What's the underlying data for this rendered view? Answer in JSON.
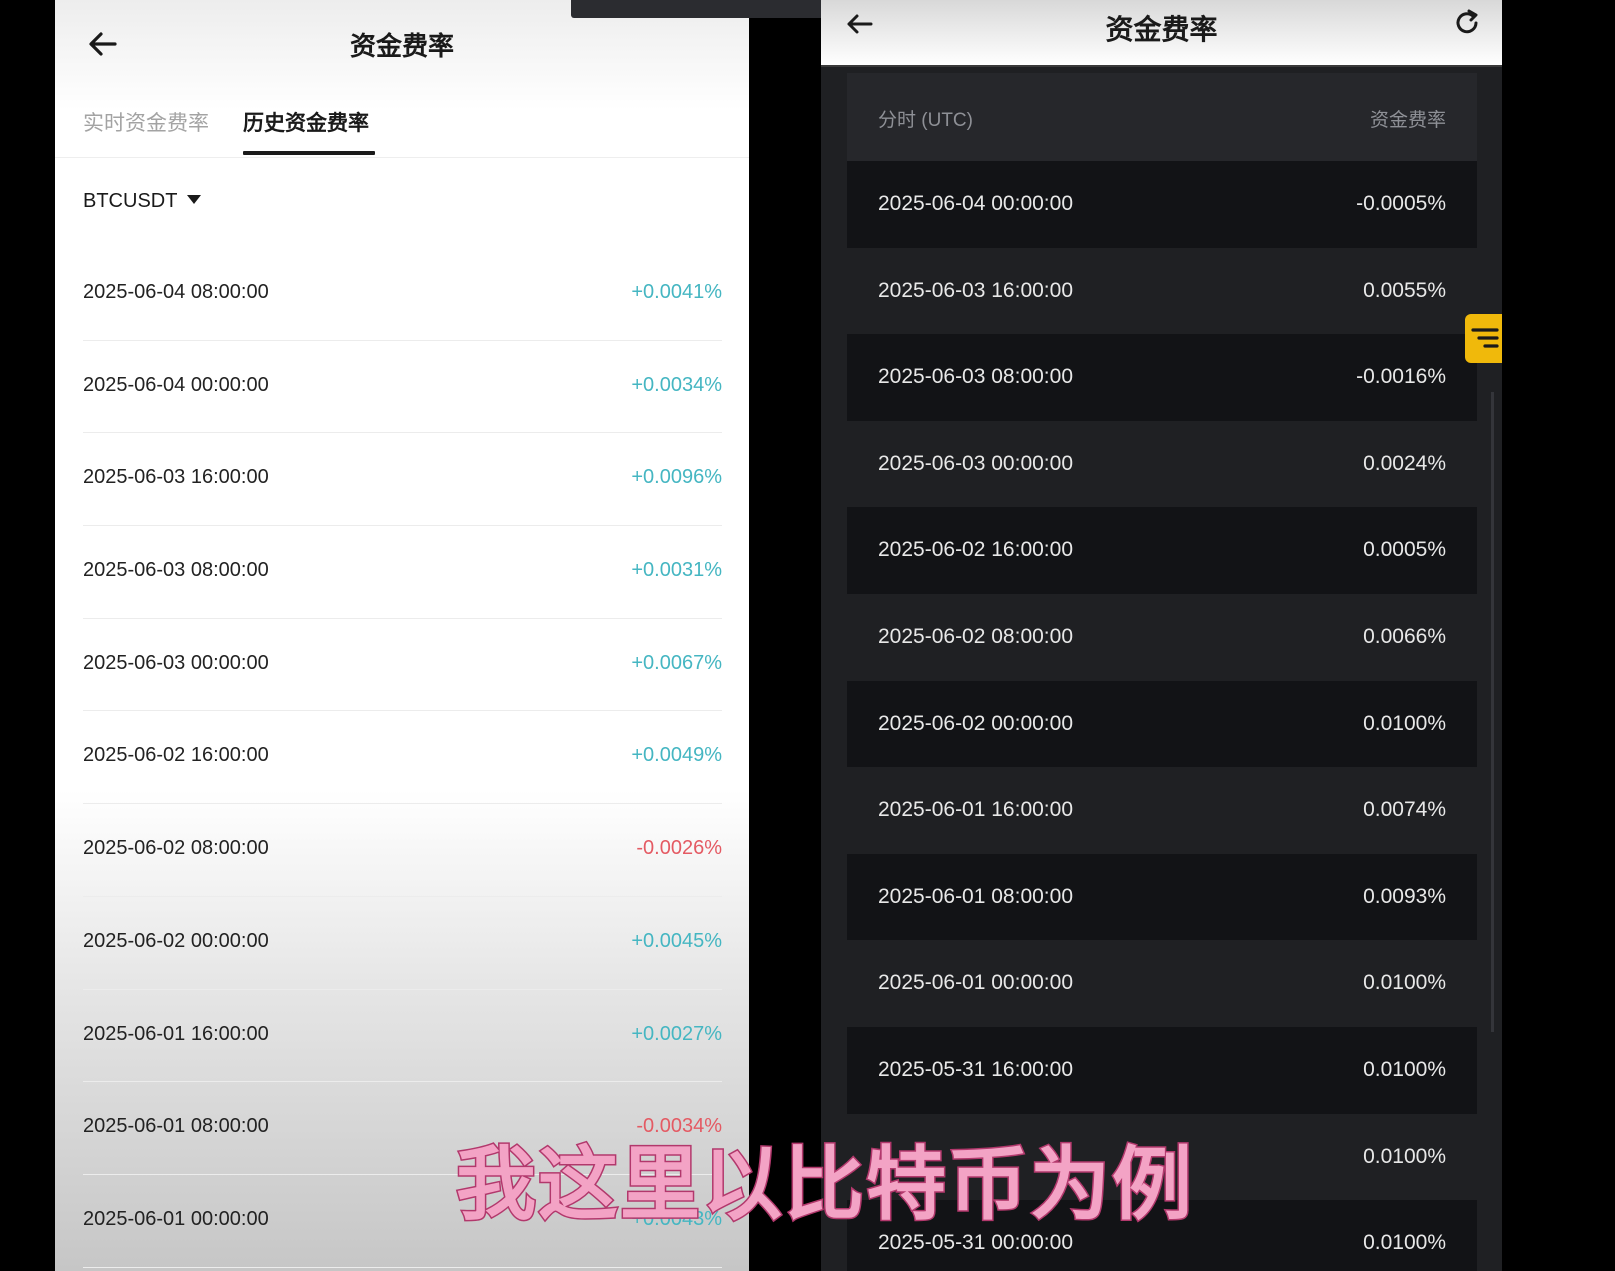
{
  "left": {
    "title": "资金费率",
    "tabs": [
      "实时资金费率",
      "历史资金费率"
    ],
    "pair": "BTCUSDT",
    "rows": [
      {
        "time": "2025-06-04 08:00:00",
        "rate": "+0.0041%",
        "sign": "pos"
      },
      {
        "time": "2025-06-04 00:00:00",
        "rate": "+0.0034%",
        "sign": "pos"
      },
      {
        "time": "2025-06-03 16:00:00",
        "rate": "+0.0096%",
        "sign": "pos"
      },
      {
        "time": "2025-06-03 08:00:00",
        "rate": "+0.0031%",
        "sign": "pos"
      },
      {
        "time": "2025-06-03 00:00:00",
        "rate": "+0.0067%",
        "sign": "pos"
      },
      {
        "time": "2025-06-02 16:00:00",
        "rate": "+0.0049%",
        "sign": "pos"
      },
      {
        "time": "2025-06-02 08:00:00",
        "rate": "-0.0026%",
        "sign": "neg"
      },
      {
        "time": "2025-06-02 00:00:00",
        "rate": "+0.0045%",
        "sign": "pos"
      },
      {
        "time": "2025-06-01 16:00:00",
        "rate": "+0.0027%",
        "sign": "pos"
      },
      {
        "time": "2025-06-01 08:00:00",
        "rate": "-0.0034%",
        "sign": "neg"
      },
      {
        "time": "2025-06-01 00:00:00",
        "rate": "+0.0043%",
        "sign": "pos"
      }
    ]
  },
  "right": {
    "title": "资金费率",
    "col_time": "分时 (UTC)",
    "col_rate": "资金费率",
    "rows": [
      {
        "time": "2025-06-04 00:00:00",
        "rate": "-0.0005%"
      },
      {
        "time": "2025-06-03 16:00:00",
        "rate": "0.0055%"
      },
      {
        "time": "2025-06-03 08:00:00",
        "rate": "-0.0016%"
      },
      {
        "time": "2025-06-03 00:00:00",
        "rate": "0.0024%"
      },
      {
        "time": "2025-06-02 16:00:00",
        "rate": "0.0005%"
      },
      {
        "time": "2025-06-02 08:00:00",
        "rate": "0.0066%"
      },
      {
        "time": "2025-06-02 00:00:00",
        "rate": "0.0100%"
      },
      {
        "time": "2025-06-01 16:00:00",
        "rate": "0.0074%"
      },
      {
        "time": "2025-06-01 08:00:00",
        "rate": "0.0093%"
      },
      {
        "time": "2025-06-01 00:00:00",
        "rate": "0.0100%"
      },
      {
        "time": "2025-05-31 16:00:00",
        "rate": "0.0100%"
      },
      {
        "time": "",
        "rate": "0.0100%"
      },
      {
        "time": "2025-05-31 00:00:00",
        "rate": "0.0100%"
      }
    ]
  },
  "subtitle": "我这里以比特币为例",
  "colors": {
    "positive": "#45b6c2",
    "negative": "#e45a63",
    "accent": "#f0b90b"
  }
}
